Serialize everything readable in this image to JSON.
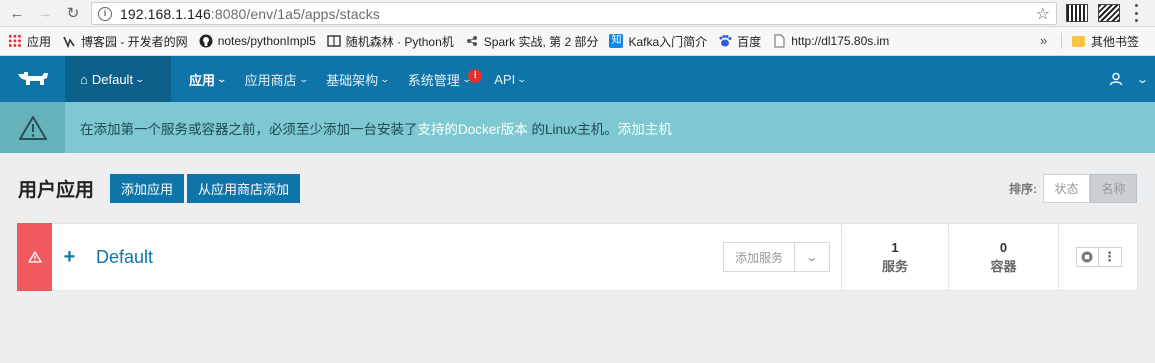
{
  "browser": {
    "url_host": "192.168.1.146",
    "url_rest": ":8080/env/1a5/apps/stacks",
    "icons": [
      "back-icon",
      "forward-icon",
      "reload-icon",
      "info-icon",
      "star-icon"
    ]
  },
  "bookmarks": {
    "items": [
      {
        "label": "应用",
        "icon": "apps-icon"
      },
      {
        "label": "博客园 - 开发者的网",
        "icon": "cnblogs-icon"
      },
      {
        "label": "notes/pythonImpl5",
        "icon": "github-icon"
      },
      {
        "label": "随机森林 · Python机",
        "icon": "book-icon"
      },
      {
        "label": "Spark 实战, 第 2 部分",
        "icon": "spark-icon"
      },
      {
        "label": "Kafka入门简介",
        "icon": "zhihu-icon"
      },
      {
        "label": "百度",
        "icon": "baidu-icon"
      },
      {
        "label": "http://dl175.80s.im",
        "icon": "page-icon"
      }
    ],
    "more": "»",
    "other_folder": "其他书签"
  },
  "topnav": {
    "environment": "Default",
    "items": [
      {
        "label": "应用",
        "active": true
      },
      {
        "label": "应用商店"
      },
      {
        "label": "基础架构"
      },
      {
        "label": "系统管理",
        "alert": "!"
      },
      {
        "label": "API"
      }
    ]
  },
  "banner": {
    "text_before": "在添加第一个服务或容器之前，必须至少添加一台安装了",
    "link1": "支持的Docker版本",
    "text_mid": " 的Linux主机。",
    "link2": "添加主机"
  },
  "page": {
    "title": "用户应用",
    "add_app": "添加应用",
    "add_from_catalog": "从应用商店添加",
    "sort_label": "排序:",
    "sort_state": "状态",
    "sort_name": "名称"
  },
  "stack": {
    "name": "Default",
    "expand": "+",
    "add_service": "添加服务",
    "services_count": "1",
    "services_label": "服务",
    "containers_count": "0",
    "containers_label": "容器",
    "more": "⋮"
  },
  "colors": {
    "nav_bg": "#0f75a8",
    "banner_bg": "#7ec8d1",
    "alert_red": "#f05a5f"
  }
}
